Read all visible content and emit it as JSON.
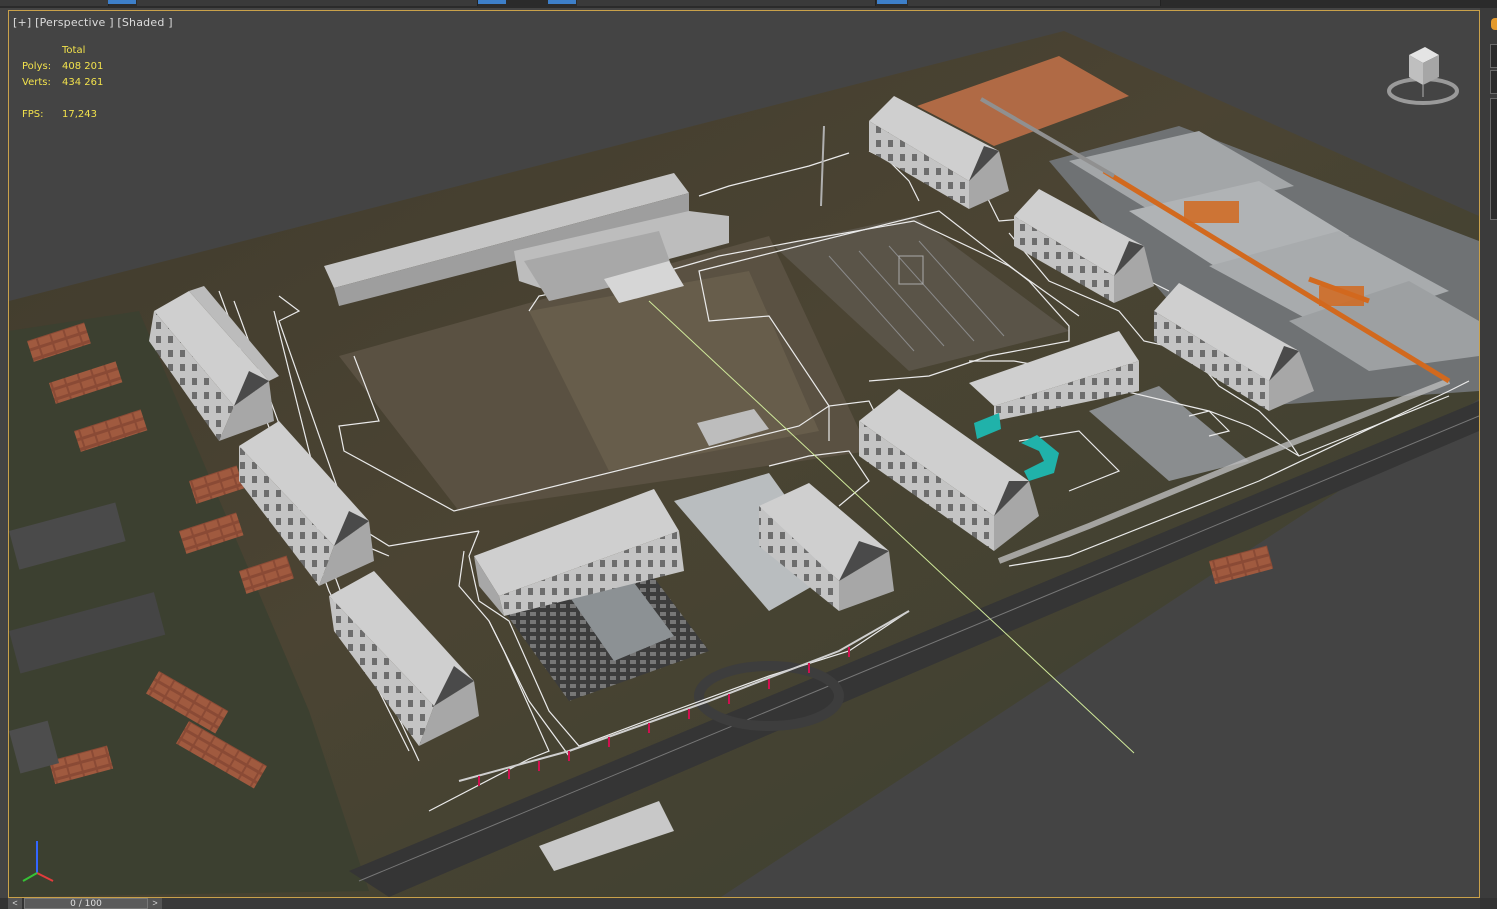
{
  "viewport": {
    "label": "[+] [Perspective ] [Shaded ]"
  },
  "stats": {
    "header": "Total",
    "polys_label": "Polys:",
    "polys_value": "408 201",
    "verts_label": "Verts:",
    "verts_value": "434 261",
    "fps_label": "FPS:",
    "fps_value": "17,243"
  },
  "timeline": {
    "frame_display": "0 / 100",
    "prev_glyph": "<",
    "next_glyph": ">",
    "current_frame": 0,
    "total_frames": 100
  },
  "colors": {
    "viewport_border": "#c9a14a",
    "stats_text": "#f2e24c",
    "accent": "#3d7fc9",
    "building": "#bdbdbd",
    "roof_dark": "#555555",
    "orange_crane": "#d2691e",
    "teal": "#20b2aa"
  },
  "icons": {
    "viewcube": "viewcube-icon",
    "axis": "axis-gizmo-icon"
  }
}
